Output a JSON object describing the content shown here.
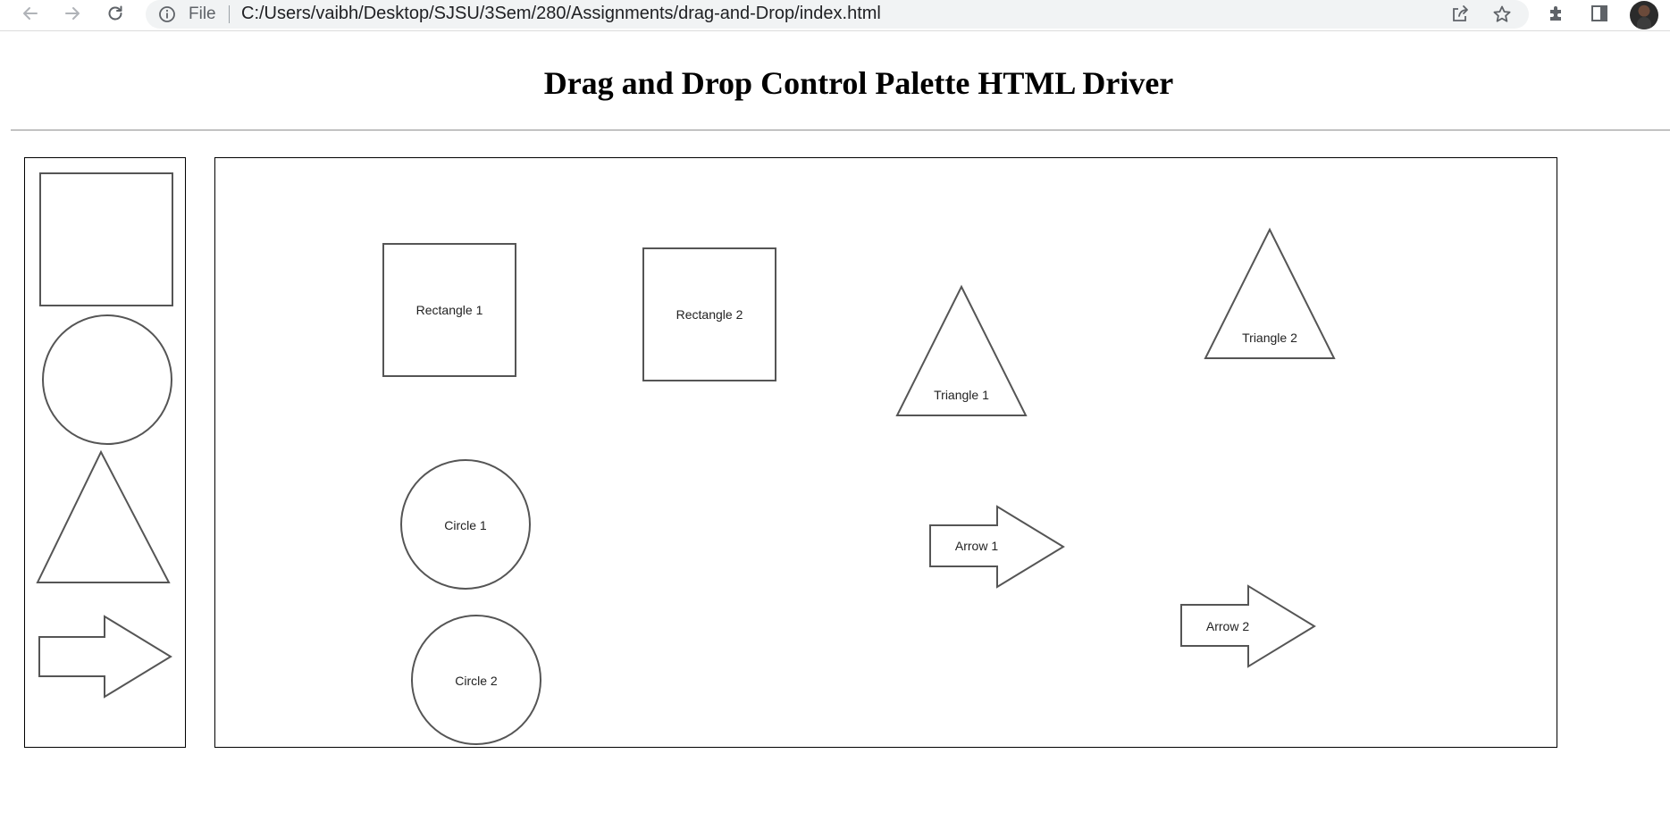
{
  "browser": {
    "omnibox": {
      "scheme_label": "File",
      "url": "C:/Users/vaibh/Desktop/SJSU/3Sem/280/Assignments/drag-and-Drop/index.html"
    },
    "icons": {
      "back": "back-arrow-icon",
      "forward": "forward-arrow-icon",
      "reload": "reload-icon",
      "info": "info-icon",
      "share": "share-icon",
      "bookmark": "star-icon",
      "extensions": "puzzle-icon",
      "side_panel": "side-panel-icon",
      "profile": "avatar"
    }
  },
  "page": {
    "title": "Drag and Drop Control Palette HTML Driver"
  },
  "palette": {
    "items": [
      {
        "shape": "rectangle"
      },
      {
        "shape": "circle"
      },
      {
        "shape": "triangle"
      },
      {
        "shape": "arrow"
      }
    ]
  },
  "canvas": {
    "shapes": [
      {
        "type": "rectangle",
        "label": "Rectangle 1"
      },
      {
        "type": "rectangle",
        "label": "Rectangle 2"
      },
      {
        "type": "triangle",
        "label": "Triangle 1"
      },
      {
        "type": "triangle",
        "label": "Triangle 2"
      },
      {
        "type": "circle",
        "label": "Circle 1"
      },
      {
        "type": "circle",
        "label": "Circle 2"
      },
      {
        "type": "arrow",
        "label": "Arrow 1"
      },
      {
        "type": "arrow",
        "label": "Arrow 2"
      }
    ]
  },
  "colors": {
    "shape_stroke": "#555555",
    "border": "#000000",
    "omnibox_bg": "#f1f3f4"
  }
}
